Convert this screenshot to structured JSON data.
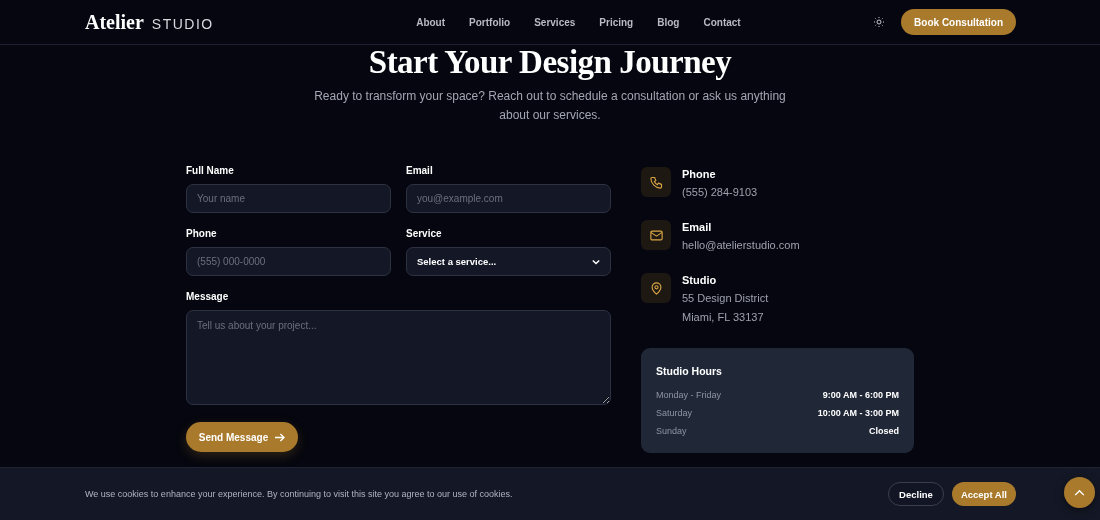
{
  "header": {
    "logo": "Atelier",
    "logo_suffix": "STUDIO",
    "nav": [
      "About",
      "Portfolio",
      "Services",
      "Pricing",
      "Blog",
      "Contact"
    ],
    "cta": "Book Consultation"
  },
  "hero": {
    "title": "Start Your Design Journey",
    "subtitle": "Ready to transform your space? Reach out to schedule a consultation or ask us anything about our services."
  },
  "form": {
    "fields": [
      {
        "kind": "input",
        "label": "Full Name",
        "placeholder": "Your name"
      },
      {
        "kind": "input",
        "label": "Email",
        "placeholder": "you@example.com"
      },
      {
        "kind": "input",
        "label": "Phone",
        "placeholder": "(555) 000-0000"
      },
      {
        "kind": "select",
        "label": "Service",
        "value": "Select a service..."
      },
      {
        "kind": "textarea",
        "label": "Message",
        "placeholder": "Tell us about your project..."
      }
    ],
    "submit": "Send Message"
  },
  "contact": [
    {
      "kind": "phone",
      "title": "Phone",
      "lines": [
        "(555) 284-9103"
      ]
    },
    {
      "kind": "email",
      "title": "Email",
      "lines": [
        "hello@atelierstudio.com"
      ]
    },
    {
      "kind": "location",
      "title": "Studio",
      "lines": [
        "55 Design District",
        "Miami, FL 33137"
      ]
    }
  ],
  "hours": {
    "title": "Studio Hours",
    "rows": [
      {
        "day": "Monday - Friday",
        "time": "9:00 AM - 6:00 PM"
      },
      {
        "day": "Saturday",
        "time": "10:00 AM - 3:00 PM"
      },
      {
        "day": "Sunday",
        "time": "Closed"
      }
    ]
  },
  "cookie_banner": {
    "text": "We use cookies to enhance your experience. By continuing to visit this site you agree to our use of cookies.",
    "buttons": [
      {
        "kind": "secondary",
        "label": "Decline"
      },
      {
        "kind": "primary",
        "label": "Accept All"
      }
    ]
  }
}
